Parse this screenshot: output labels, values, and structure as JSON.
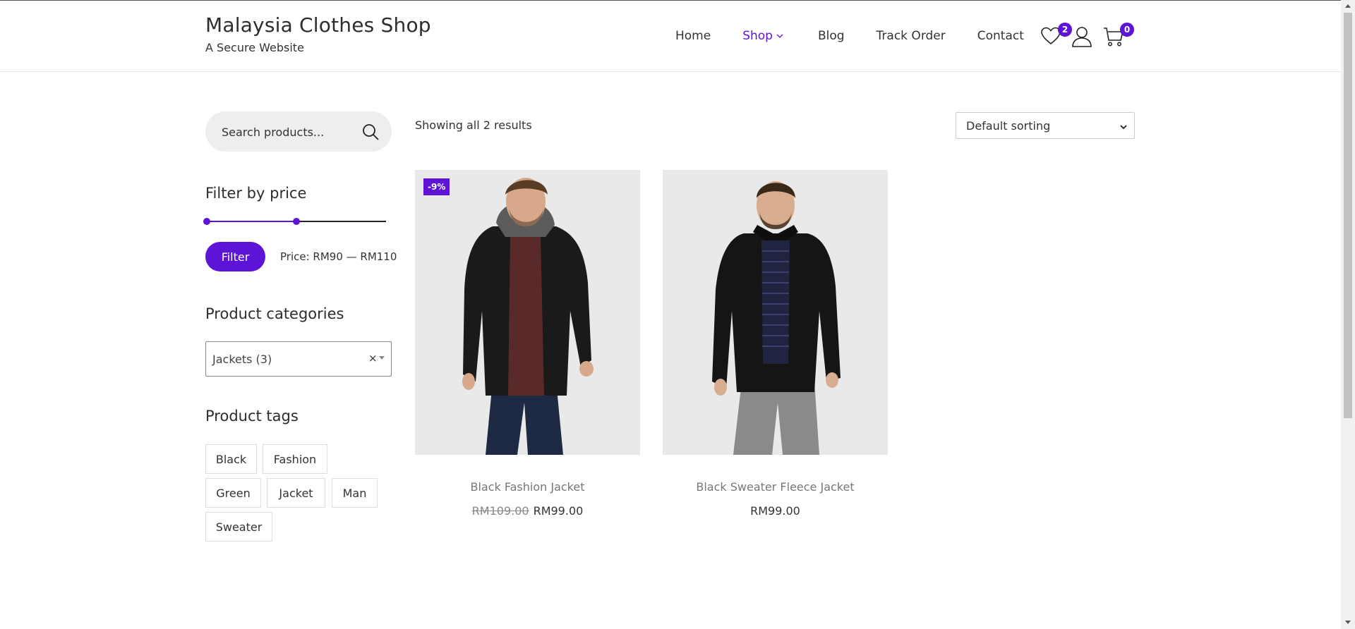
{
  "header": {
    "site_title": "Malaysia Clothes Shop",
    "tagline": "A Secure Website",
    "nav": [
      {
        "label": "Home"
      },
      {
        "label": "Shop"
      },
      {
        "label": "Blog"
      },
      {
        "label": "Track Order"
      },
      {
        "label": "Contact"
      }
    ],
    "wishlist_count": "2",
    "cart_count": "0",
    "accent_color": "#5d14d6"
  },
  "sidebar": {
    "search": {
      "placeholder": "Search products..."
    },
    "price_filter": {
      "title": "Filter by price",
      "button_label": "Filter",
      "price_text": "Price: RM90 — RM110",
      "range_fraction": [
        0,
        0.5
      ]
    },
    "categories": {
      "title": "Product categories",
      "selected": "Jackets  (3)",
      "clear": "×"
    },
    "tags": {
      "title": "Product tags",
      "items": [
        "Black",
        "Fashion",
        "Green",
        "Jacket",
        "Man",
        "Sweater"
      ]
    }
  },
  "main": {
    "result_count": "Showing all 2 results",
    "sorting": "Default sorting",
    "products": [
      {
        "title": "Black Fashion Jacket",
        "old_price": "RM109.00",
        "price": "RM99.00",
        "sale_badge": "-9%"
      },
      {
        "title": "Black Sweater Fleece Jacket",
        "price": "RM99.00"
      }
    ]
  }
}
